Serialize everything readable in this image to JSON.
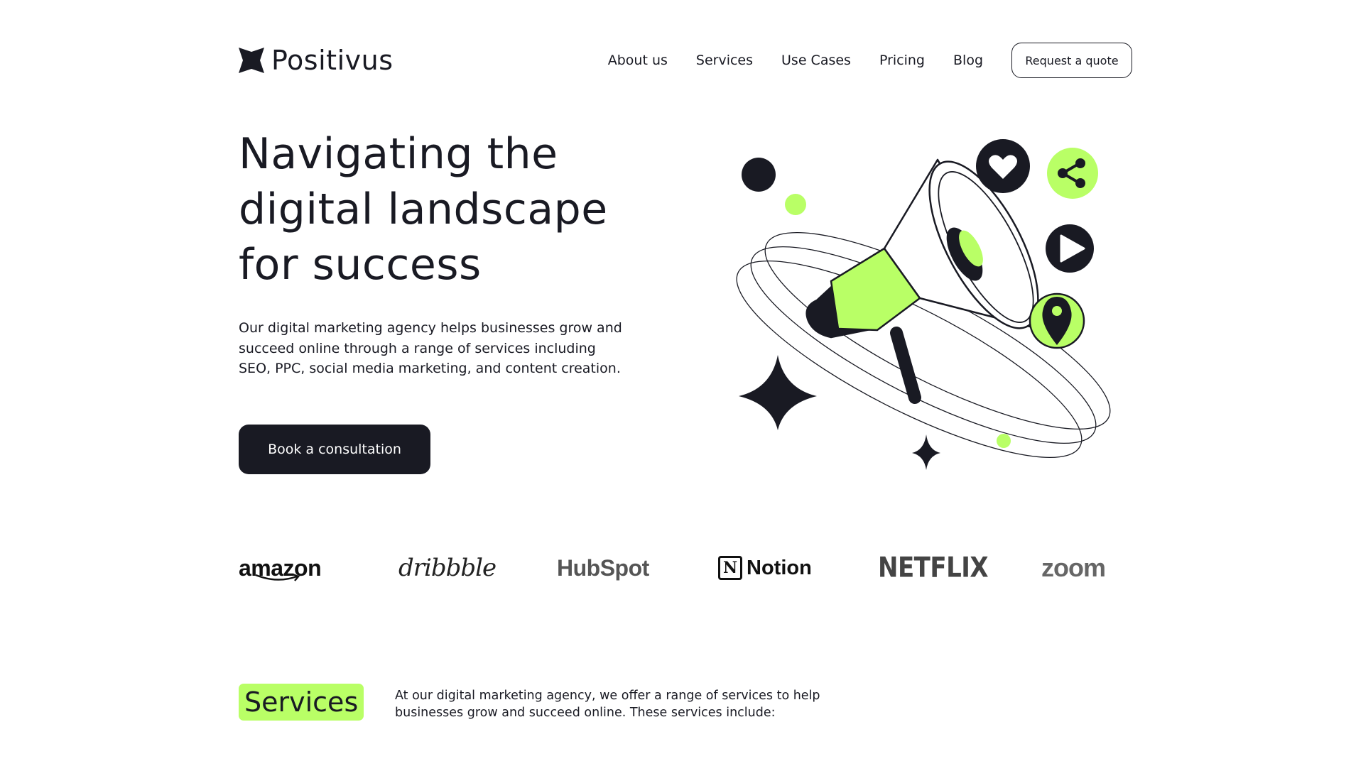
{
  "brand": {
    "name": "Positivus"
  },
  "nav": {
    "items": [
      {
        "label": "About us"
      },
      {
        "label": "Services"
      },
      {
        "label": "Use Cases"
      },
      {
        "label": "Pricing"
      },
      {
        "label": "Blog"
      }
    ],
    "cta_label": "Request a quote"
  },
  "hero": {
    "title_line1": "Navigating the",
    "title_line2": "digital landscape",
    "title_line3": "for success",
    "description": "Our digital marketing agency helps businesses grow and succeed online through a range of services including SEO, PPC, social media marketing, and content creation.",
    "cta_label": "Book a consultation",
    "illustration_icons": [
      "heart-icon",
      "share-icon",
      "play-icon",
      "location-pin-icon",
      "megaphone-icon",
      "sparkle-star-icon"
    ]
  },
  "clients": {
    "logos": [
      {
        "name": "amazon"
      },
      {
        "name": "dribbble"
      },
      {
        "name": "HubSpot"
      },
      {
        "name": "Notion"
      },
      {
        "name": "NETFLIX"
      },
      {
        "name": "zoom"
      }
    ]
  },
  "services": {
    "heading": "Services",
    "description": "At our digital marketing agency, we offer a range of services to help businesses grow and succeed online. These services include:"
  },
  "colors": {
    "accent": "#b9ff66",
    "dark": "#191a23",
    "background": "#ffffff"
  }
}
